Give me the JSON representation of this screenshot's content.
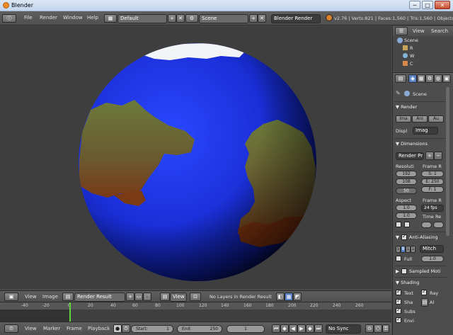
{
  "window": {
    "title": "Blender",
    "min_glyph": "─",
    "max_glyph": "□",
    "close_glyph": "✕"
  },
  "info": {
    "menus": [
      "File",
      "Render",
      "Window",
      "Help"
    ],
    "screen": "Default",
    "scene": "Scene",
    "engine": "Blender Render",
    "stats": "v2.76 | Verts:821 | Faces:1,560 | Tris:1,560 | Objects"
  },
  "outliner": {
    "view": "View",
    "search": "Search",
    "items": [
      "Scene",
      "R",
      "W",
      "C"
    ]
  },
  "properties": {
    "scene": "Scene",
    "render": {
      "title": "Render",
      "buttons": [
        "Ima",
        "Ani",
        "Au"
      ],
      "display_label": "Displ",
      "display_value": "Imag"
    },
    "dimensions": {
      "title": "Dimensions",
      "preset": "Render Pr",
      "resolution_label": "Resoluti",
      "res_x": "192",
      "res_y": "108",
      "res_pct": "50",
      "frame_range_label": "Frame R",
      "frame_start": "S: 1",
      "frame_end": "E: 250",
      "frame_step": "F: 1",
      "aspect_label": "Aspect",
      "aspect_x": "1.0",
      "aspect_y": "1.0",
      "frame_rate_label": "Frame R",
      "fps": "24 fps",
      "time_remap": "Time Re"
    },
    "anti_aliasing": {
      "title": "Anti-Aliasing",
      "samples": [
        "5",
        "8",
        "1",
        "1"
      ],
      "filter": "Mitch",
      "full": "Full",
      "size": "1.0"
    },
    "sampled_motion": {
      "title": "Sampled Moti"
    },
    "shading": {
      "title": "Shading",
      "options": [
        "Text",
        "Ray",
        "Sha",
        "Al",
        "Subs",
        "Envi"
      ]
    }
  },
  "image_editor": {
    "view": "View",
    "image": "Image",
    "image_name": "Render Result",
    "view2": "View",
    "layers": "No Layers in Render Result"
  },
  "timeline": {
    "ticks": [
      "-40",
      "-20",
      "0",
      "20",
      "40",
      "60",
      "80",
      "100",
      "120",
      "140",
      "160",
      "180",
      "200",
      "220",
      "240",
      "260"
    ],
    "menus": [
      "View",
      "Marker",
      "Frame",
      "Playback"
    ],
    "start": "Start:",
    "start_value": "1",
    "end": "End:",
    "end_value": "250",
    "current": "1",
    "sync": "No Sync"
  }
}
